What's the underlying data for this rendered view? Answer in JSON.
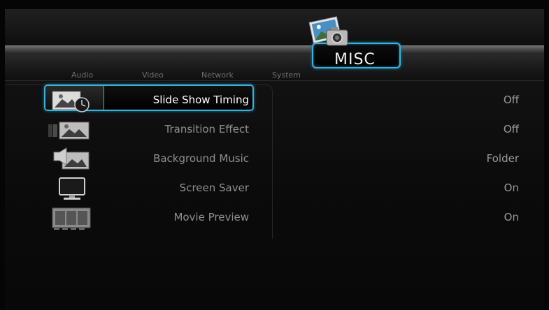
{
  "tabs": [
    {
      "id": "audio",
      "label": "Audio"
    },
    {
      "id": "video",
      "label": "Video"
    },
    {
      "id": "network",
      "label": "Network"
    },
    {
      "id": "system",
      "label": "System"
    }
  ],
  "active_tab": {
    "label": "MISC",
    "icon": "photo-camera-icon"
  },
  "menu": [
    {
      "label": "Slide Show Timing",
      "value": "Off",
      "icon": "slideshow-timer-icon",
      "selected": true
    },
    {
      "label": "Transition Effect",
      "value": "Off",
      "icon": "transition-icon",
      "selected": false
    },
    {
      "label": "Background Music",
      "value": "Folder",
      "icon": "music-slideshow-icon",
      "selected": false
    },
    {
      "label": "Screen Saver",
      "value": "On",
      "icon": "monitor-icon",
      "selected": false
    },
    {
      "label": "Movie Preview",
      "value": "On",
      "icon": "film-strip-icon",
      "selected": false
    }
  ],
  "colors": {
    "accent": "#3ab2d8",
    "background": "#0b0b0b",
    "text_selected": "#ffffff",
    "text_normal": "#8f8f8f"
  }
}
